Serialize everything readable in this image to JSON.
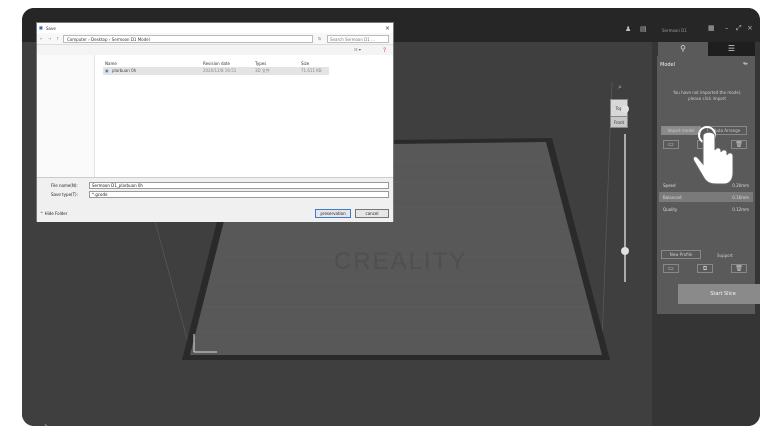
{
  "titlebar": {
    "account": "Sermoon D1",
    "left_text": ""
  },
  "viewport": {
    "watermark": "CREALITY",
    "cube_top": "Top",
    "cube_front": "Front"
  },
  "panel": {
    "tab_prepare_icon": "search-icon",
    "tab_preview_icon": "layers-icon",
    "model_label": "Model",
    "no_model_msg": "You have not imported the model, please click import",
    "import_label": "Import model",
    "arrange_label": "Auto Arrange",
    "params": [
      {
        "name": "Speed",
        "value": "0.20mm"
      },
      {
        "name": "Balanced",
        "value": "0.16mm"
      },
      {
        "name": "Quality",
        "value": "0.12mm"
      }
    ],
    "new_profile_label": "New Profile",
    "support_label": "Support",
    "start_slice_label": "Start Slice"
  },
  "dialog": {
    "title": "Save",
    "address": "Computer › Desktop › Sermoon D1 Model",
    "search_placeholder": "Search Sermoon D1 ...",
    "columns": [
      "Name",
      "Revision date",
      "Types",
      "Size"
    ],
    "files": [
      {
        "name": "plarbuan 0h",
        "date": "2020/12/8 16:51",
        "type": "3D 文件",
        "size": "71,611 KB"
      }
    ],
    "file_name_label": "File name(N):",
    "file_name_value": "Sermoon D1_plarbuan 0h",
    "save_type_label": "Save type(T):",
    "save_type_value": "*.gcode",
    "hide_folder_label": "Hide Folder",
    "preservation_label": "preservation",
    "cancel_label": "cancel"
  }
}
